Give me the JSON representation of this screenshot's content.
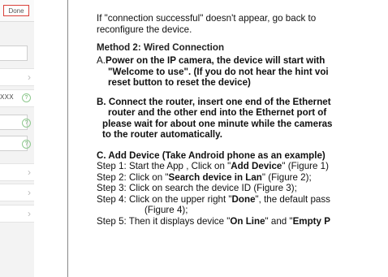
{
  "phone": {
    "done_label": "Done",
    "password_mask": "XXX"
  },
  "doc": {
    "intro_1": "If \"connection successful\" doesn't appear, go back to",
    "intro_2": "reconfigure the device.",
    "method2_heading": "Method 2: Wired Connection",
    "a_1a": "A.",
    "a_1b": "Power on the IP camera, the device will start with",
    "a_2": "\"Welcome to use\". (If you do not hear the hint voi",
    "a_3": "reset button to reset the device)",
    "b_1": "B. Connect the router, insert one end of the Ethernet",
    "b_2": "router and the other end into the Ethernet port of",
    "b_3": "please wait for about one minute while the cameras",
    "b_4": "to the router automatically.",
    "c_1": "C. Add Device (Take Android phone as an example)",
    "step1_a": "Step 1: Start the App , Click on \"",
    "step1_b": "Add Device",
    "step1_c": "\" (Figure 1)",
    "step2_a": "Step 2: Click on \"",
    "step2_b": "Search device in Lan",
    "step2_c": "\" (Figure 2);",
    "step3": "Step 3: Click on search the device ID (Figure 3);",
    "step4_a": "Step 4: Click on the upper right \"",
    "step4_b": "Done",
    "step4_c": "\", the default pass",
    "step4_d": "(Figure 4);",
    "step5_a": "Step 5: Then it displays device \"",
    "step5_b": "On Line",
    "step5_c": "\" and \"",
    "step5_d": "Empty P"
  }
}
